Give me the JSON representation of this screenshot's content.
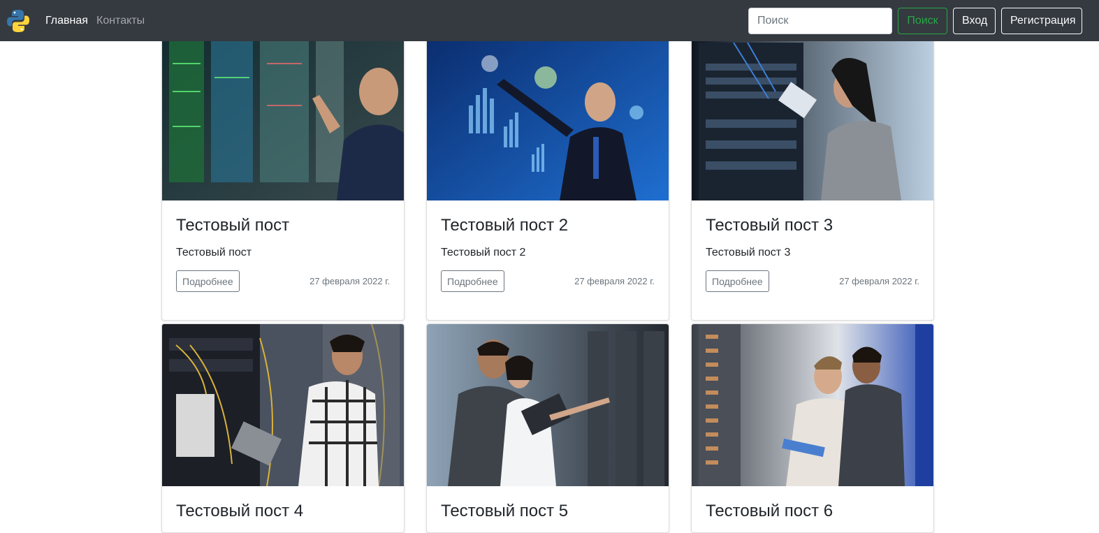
{
  "navbar": {
    "home": "Главная",
    "contacts": "Контакты",
    "search_placeholder": "Поиск",
    "search_button": "Поиск",
    "login_button": "Вход",
    "register_button": "Регистрация"
  },
  "posts": [
    {
      "title": "Тестовый пост",
      "text": "Тестовый пост",
      "more": "Подробнее",
      "date": "27 февраля 2022 г."
    },
    {
      "title": "Тестовый пост 2",
      "text": "Тестовый пост 2",
      "more": "Подробнее",
      "date": "27 февраля 2022 г."
    },
    {
      "title": "Тестовый пост 3",
      "text": "Тестовый пост 3",
      "more": "Подробнее",
      "date": "27 февраля 2022 г."
    },
    {
      "title": "Тестовый пост 4"
    },
    {
      "title": "Тестовый пост 5"
    },
    {
      "title": "Тестовый пост 6"
    }
  ],
  "colors": {
    "navbar": "#343a40",
    "success": "#28a745",
    "secondary": "#6c757d"
  },
  "icons": {
    "logo": "python-logo-icon"
  }
}
